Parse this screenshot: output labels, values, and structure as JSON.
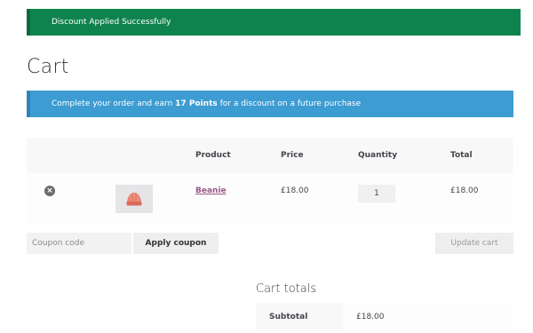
{
  "notices": {
    "success": "Discount Applied Successfully",
    "info_prefix": "Complete your order and earn ",
    "info_points": "17 Points",
    "info_suffix": " for a discount on a future purchase"
  },
  "page": {
    "title": "Cart"
  },
  "cart": {
    "headers": {
      "product": "Product",
      "price": "Price",
      "quantity": "Quantity",
      "total": "Total"
    },
    "items": [
      {
        "remove": "×",
        "thumbnail_icon": "beanie-hat-icon",
        "name": "Beanie",
        "price": "£18.00",
        "quantity": "1",
        "total": "£18.00"
      }
    ]
  },
  "actions": {
    "coupon_placeholder": "Coupon code",
    "apply_coupon": "Apply coupon",
    "update_cart": "Update cart"
  },
  "totals": {
    "title": "Cart totals",
    "subtotal_label": "Subtotal",
    "subtotal_value": "£18.00"
  },
  "colors": {
    "success": "#0f834d",
    "info": "#3d9cd2",
    "product_link": "#96588a",
    "beanie": "#e8806c"
  }
}
